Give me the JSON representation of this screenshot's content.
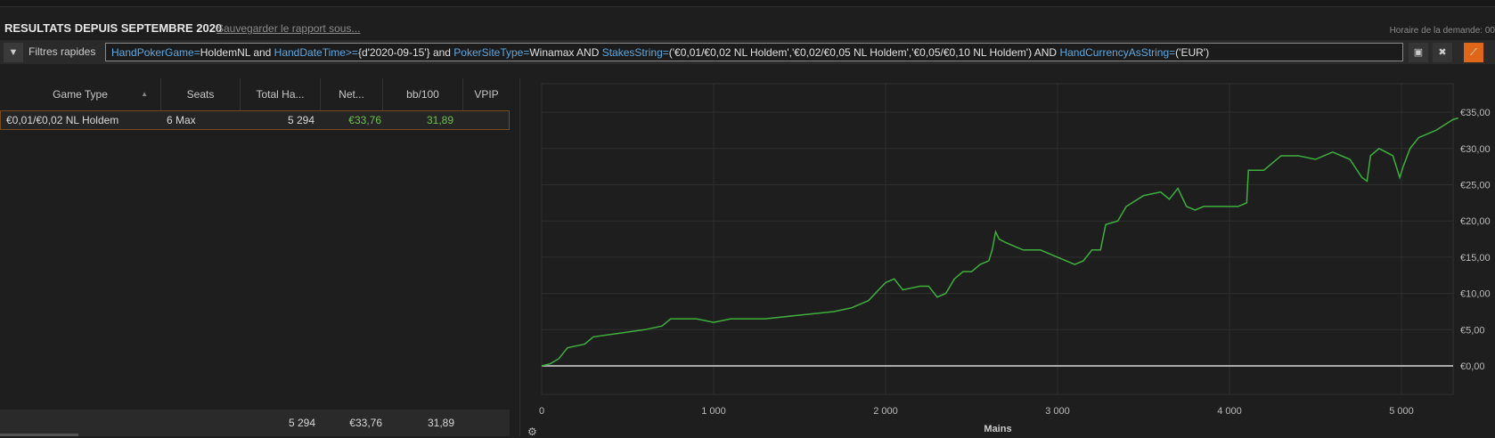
{
  "header": {
    "title": "RESULTATS DEPUIS SEPTEMBRE 2020",
    "save_link": "Sauvegarder le rapport sous...",
    "request_time": "Horaire de la demande: 00"
  },
  "filter": {
    "label": "Filtres rapides",
    "icon": "funnel-icon",
    "tokens": [
      {
        "t": "HandPokerGame=",
        "k": true
      },
      {
        "t": "HoldemNL and ",
        "k": false
      },
      {
        "t": "HandDateTime>=",
        "k": true
      },
      {
        "t": "{d'2020-09-15'} and ",
        "k": false
      },
      {
        "t": "PokerSiteType=",
        "k": true
      },
      {
        "t": "Winamax AND ",
        "k": false
      },
      {
        "t": "StakesString=",
        "k": true
      },
      {
        "t": "('€0,01/€0,02 NL Holdem','€0,02/€0,05 NL Holdem','€0,05/€0,10 NL Holdem') AND ",
        "k": false
      },
      {
        "t": "HandCurrencyAsString=",
        "k": true
      },
      {
        "t": "('EUR')",
        "k": false
      }
    ],
    "buttons": [
      "save-icon",
      "close-icon",
      "chart-icon"
    ]
  },
  "table": {
    "columns": [
      "Game Type",
      "Seats",
      "Total Ha...",
      "Net...",
      "bb/100",
      "VPIP"
    ],
    "rows": [
      {
        "game_type": "€0,01/€0,02 NL Holdem",
        "seats": "6 Max",
        "total_hands": "5 294",
        "net": "€33,76",
        "bb100": "31,89"
      }
    ],
    "totals": {
      "total_hands": "5 294",
      "net": "€33,76",
      "bb100": "31,89"
    }
  },
  "colors": {
    "accent": "#e0661a",
    "line": "#3db03d",
    "keyword": "#5fa8e0",
    "positive": "#6cc24a"
  },
  "chart_data": {
    "type": "line",
    "xlabel": "Mains",
    "ylabel": "",
    "xlim": [
      0,
      5300
    ],
    "ylim": [
      -7,
      39
    ],
    "xticks": [
      0,
      1000,
      2000,
      3000,
      4000,
      5000
    ],
    "xtick_labels": [
      "0",
      "1 000",
      "2 000",
      "3 000",
      "4 000",
      "5 000"
    ],
    "yticks": [
      0,
      5,
      10,
      15,
      20,
      25,
      30,
      35
    ],
    "ytick_labels": [
      "€0,00",
      "€5,00",
      "€10,00",
      "€15,00",
      "€20,00",
      "€25,00",
      "€30,00",
      "€35,00"
    ],
    "grid": true,
    "series": [
      {
        "values": [
          [
            0,
            0
          ],
          [
            50,
            0.3
          ],
          [
            100,
            1
          ],
          [
            150,
            2.5
          ],
          [
            250,
            3
          ],
          [
            300,
            4
          ],
          [
            450,
            4.5
          ],
          [
            600,
            5
          ],
          [
            700,
            5.5
          ],
          [
            750,
            6.5
          ],
          [
            900,
            6.5
          ],
          [
            1000,
            6
          ],
          [
            1100,
            6.5
          ],
          [
            1300,
            6.5
          ],
          [
            1500,
            7
          ],
          [
            1700,
            7.5
          ],
          [
            1800,
            8
          ],
          [
            1900,
            9
          ],
          [
            2000,
            11.5
          ],
          [
            2050,
            12
          ],
          [
            2100,
            10.5
          ],
          [
            2200,
            11
          ],
          [
            2250,
            11
          ],
          [
            2300,
            9.5
          ],
          [
            2350,
            10
          ],
          [
            2400,
            12
          ],
          [
            2450,
            13
          ],
          [
            2500,
            13
          ],
          [
            2550,
            14
          ],
          [
            2600,
            14.5
          ],
          [
            2620,
            16
          ],
          [
            2640,
            18.5
          ],
          [
            2660,
            17.5
          ],
          [
            2700,
            17
          ],
          [
            2800,
            16
          ],
          [
            2900,
            16
          ],
          [
            3000,
            15
          ],
          [
            3100,
            14
          ],
          [
            3150,
            14.5
          ],
          [
            3200,
            16
          ],
          [
            3250,
            16
          ],
          [
            3280,
            19.5
          ],
          [
            3350,
            20
          ],
          [
            3400,
            22
          ],
          [
            3500,
            23.5
          ],
          [
            3600,
            24
          ],
          [
            3650,
            23
          ],
          [
            3700,
            24.5
          ],
          [
            3750,
            22
          ],
          [
            3800,
            21.5
          ],
          [
            3850,
            22
          ],
          [
            3950,
            22
          ],
          [
            4050,
            22
          ],
          [
            4100,
            22.5
          ],
          [
            4110,
            27
          ],
          [
            4200,
            27
          ],
          [
            4300,
            29
          ],
          [
            4400,
            29
          ],
          [
            4500,
            28.5
          ],
          [
            4600,
            29.5
          ],
          [
            4700,
            28.5
          ],
          [
            4770,
            26
          ],
          [
            4800,
            25.5
          ],
          [
            4820,
            29
          ],
          [
            4870,
            30
          ],
          [
            4950,
            29
          ],
          [
            4990,
            26
          ],
          [
            5010,
            27.5
          ],
          [
            5050,
            30
          ],
          [
            5100,
            31.5
          ],
          [
            5200,
            32.5
          ],
          [
            5300,
            34
          ],
          [
            5330,
            34.2
          ]
        ]
      }
    ],
    "baseline": 0
  }
}
